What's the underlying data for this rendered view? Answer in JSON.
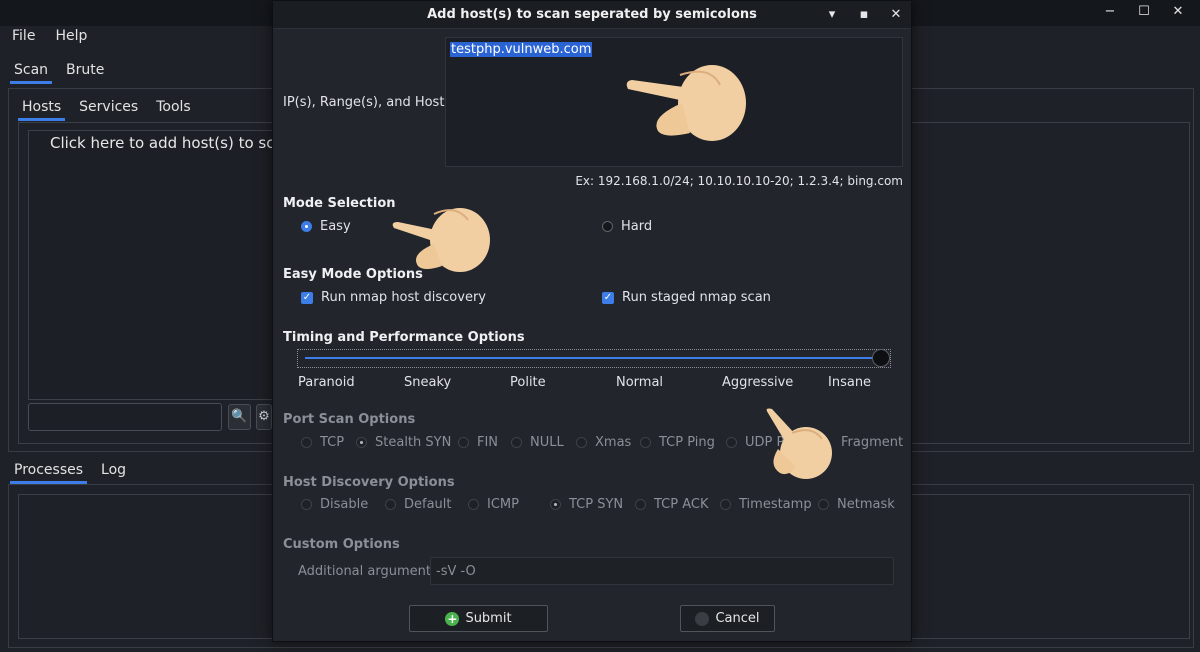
{
  "main": {
    "menu": [
      "File",
      "Help"
    ],
    "tabs": [
      "Scan",
      "Brute"
    ],
    "subtabs": [
      "Hosts",
      "Services",
      "Tools"
    ],
    "click_hint": "Click here to add host(s) to scop",
    "bottom_tabs": [
      "Processes",
      "Log"
    ],
    "window_controls": [
      "−",
      "☐",
      "✕"
    ]
  },
  "dialog": {
    "title": "Add host(s) to scan seperated by semicolons",
    "controls": [
      "▾",
      "▪",
      "✕"
    ],
    "hosts_label": "IP(s), Range(s), and Host(s)",
    "hosts_value": "testphp.vulnweb.com",
    "example": "Ex: 192.168.1.0/24; 10.10.10.10-20; 1.2.3.4; bing.com",
    "mode_title": "Mode Selection",
    "mode_easy": "Easy",
    "mode_hard": "Hard",
    "easy_title": "Easy Mode Options",
    "easy_discovery": "Run nmap host discovery",
    "easy_staged": "Run staged nmap scan",
    "timing_title": "Timing and Performance Options",
    "timing_levels": [
      "Paranoid",
      "Sneaky",
      "Polite",
      "Normal",
      "Aggressive",
      "Insane"
    ],
    "timing_selected": "Insane",
    "port_title": "Port Scan Options",
    "port_options": [
      "TCP",
      "Stealth SYN",
      "FIN",
      "NULL",
      "Xmas",
      "TCP Ping",
      "UDP P",
      "Fragment"
    ],
    "port_selected": "Stealth SYN",
    "host_title": "Host Discovery Options",
    "host_options": [
      "Disable",
      "Default",
      "ICMP",
      "TCP SYN",
      "TCP ACK",
      "Timestamp",
      "Netmask"
    ],
    "host_selected": "TCP SYN",
    "custom_title": "Custom Options",
    "args_label": "Additional arguments",
    "args_value": "-sV -O",
    "submit": "Submit",
    "cancel": "Cancel"
  },
  "colors": {
    "accent": "#3d7de8",
    "submit_icon": "#4bb34e",
    "pointer_hand": "#f2cfa3"
  },
  "icons": [
    "search-icon",
    "settings-icon",
    "pointer-hand-icon",
    "add-icon",
    "cancel-icon"
  ]
}
